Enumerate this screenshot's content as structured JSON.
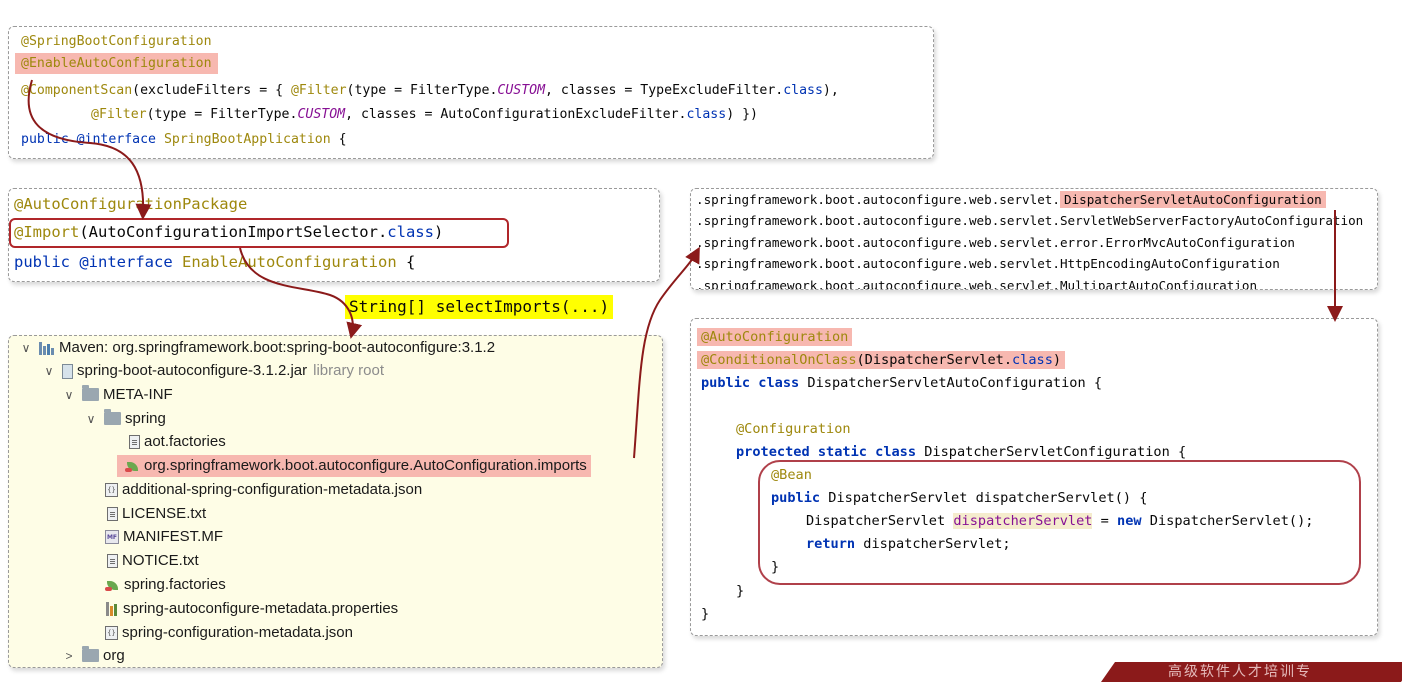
{
  "top_code": {
    "line1": "@SpringBootConfiguration",
    "line2": "@EnableAutoConfiguration",
    "line3_ann": "@ComponentScan",
    "line3_a": "(excludeFilters = { ",
    "line3_ann2": "@Filter",
    "line3_b": "(type = FilterType.",
    "line3_custom": "CUSTOM",
    "line3_c": ", classes = TypeExcludeFilter.",
    "line3_class": "class",
    "line3_d": "),",
    "line4_ann": "@Filter",
    "line4_a": "(type = FilterType.",
    "line4_custom": "CUSTOM",
    "line4_b": ", classes = AutoConfigurationExcludeFilter.",
    "line4_class": "class",
    "line4_c": ") })",
    "line5_kw": "public",
    "line5_kw2": "@interface",
    "line5_name": "SpringBootApplication",
    "line5_brace": " {"
  },
  "mid_code": {
    "line1": "@AutoConfigurationPackage",
    "line2_ann": "@Import",
    "line2_a": "(AutoConfigurationImportSelector.",
    "line2_class": "class",
    "line2_b": ")",
    "line3_kw": "public",
    "line3_kw2": "@interface",
    "line3_name": "EnableAutoConfiguration",
    "line3_brace": " {"
  },
  "select_imports": "String[] selectImports(...)",
  "imports_file": {
    "prefix": ".springframework.boot.autoconfigure.web.servlet.",
    "lines": [
      "DispatcherServletAutoConfiguration",
      "ServletWebServerFactoryAutoConfiguration",
      "error.ErrorMvcAutoConfiguration",
      "HttpEncodingAutoConfiguration",
      "MultipartAutoConfiguration"
    ]
  },
  "right_code": {
    "l1": "@AutoConfiguration",
    "l2_ann": "@ConditionalOnClass",
    "l2_a": "(DispatcherServlet.",
    "l2_class": "class",
    "l2_b": ")",
    "l3_kw": "public class",
    "l3_rest": " DispatcherServletAutoConfiguration {",
    "l4": "@Configuration",
    "l5_kw": "protected static class",
    "l5_rest": " DispatcherServletConfiguration {",
    "l6": "@Bean",
    "l7_kw": "public",
    "l7_rest": " DispatcherServlet dispatcherServlet() {",
    "l8_a": "DispatcherServlet ",
    "l8_var": "dispatcherServlet",
    "l8_b": " = ",
    "l8_kw": "new",
    "l8_c": " DispatcherServlet();",
    "l9_kw": "return",
    "l9_rest": " dispatcherServlet;",
    "l10": "}",
    "l11": "}",
    "l12": "}"
  },
  "tree": {
    "root": "Maven: org.springframework.boot:spring-boot-autoconfigure:3.1.2",
    "jar": "spring-boot-autoconfigure-3.1.2.jar",
    "jar_note": "library root",
    "meta_inf": "META-INF",
    "spring_folder": "spring",
    "aot_factories": "aot.factories",
    "imports_file": "org.springframework.boot.autoconfigure.AutoConfiguration.imports",
    "additional_metadata": "additional-spring-configuration-metadata.json",
    "license": "LICENSE.txt",
    "manifest": "MANIFEST.MF",
    "notice": "NOTICE.txt",
    "spring_factories": "spring.factories",
    "autoconfigure_metadata": "spring-autoconfigure-metadata.properties",
    "configuration_metadata": "spring-configuration-metadata.json",
    "org_folder": "org"
  },
  "banner_text": "高级软件人才培训专",
  "colors": {
    "annotation": "#9e880d",
    "keyword": "#0033b3",
    "highlight_red": "#f7b8b0",
    "arrow": "#8b1a1a",
    "tree_bg": "#fefde6",
    "select_bg": "#ffff00"
  }
}
